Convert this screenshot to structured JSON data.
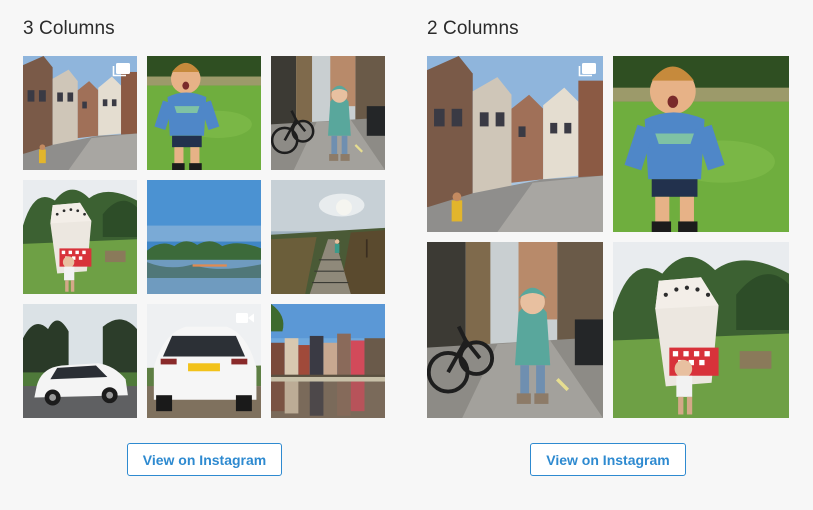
{
  "panels": [
    {
      "title": "3 Columns",
      "button_label": "View on Instagram",
      "photos": [
        {
          "subject": "canal-street-houses",
          "badge": "carousel-icon"
        },
        {
          "subject": "boy-running-grass",
          "badge": ""
        },
        {
          "subject": "girl-alley-bicycles",
          "badge": ""
        },
        {
          "subject": "market-tent-garden",
          "badge": ""
        },
        {
          "subject": "lake-blue-sky",
          "badge": ""
        },
        {
          "subject": "child-heath-path",
          "badge": ""
        },
        {
          "subject": "white-suv-trees",
          "badge": ""
        },
        {
          "subject": "white-suv-rear",
          "badge": "video-icon"
        },
        {
          "subject": "canal-houses-reflection",
          "badge": ""
        }
      ]
    },
    {
      "title": "2 Columns",
      "button_label": "View on Instagram",
      "photos": [
        {
          "subject": "canal-street-houses",
          "badge": "carousel-icon"
        },
        {
          "subject": "boy-running-grass",
          "badge": ""
        },
        {
          "subject": "girl-alley-bicycles",
          "badge": ""
        },
        {
          "subject": "market-tent-garden",
          "badge": ""
        }
      ]
    }
  ],
  "colors": {
    "background": "#f7f7f7",
    "title_text": "#2b2b2b",
    "accent": "#2e8ad0",
    "button_bg": "#ffffff"
  }
}
